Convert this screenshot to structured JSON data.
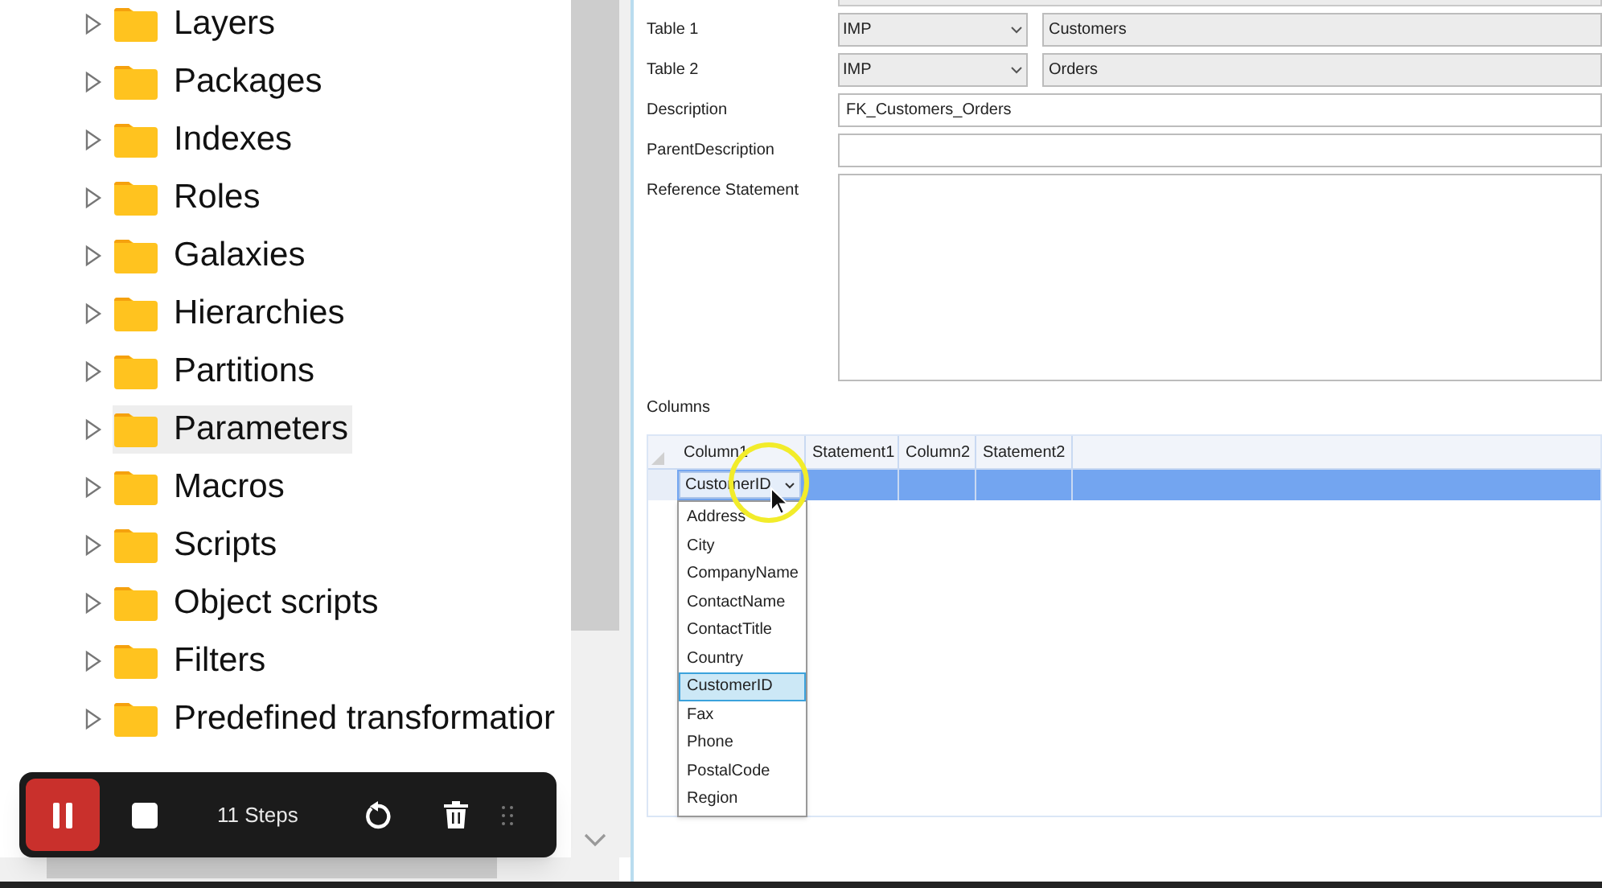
{
  "tree": {
    "items": [
      {
        "label": "Layers",
        "expanded": false,
        "selected": false
      },
      {
        "label": "Packages",
        "expanded": false,
        "selected": false
      },
      {
        "label": "Indexes",
        "expanded": false,
        "selected": false
      },
      {
        "label": "Roles",
        "expanded": false,
        "selected": false
      },
      {
        "label": "Galaxies",
        "expanded": false,
        "selected": false
      },
      {
        "label": "Hierarchies",
        "expanded": false,
        "selected": false
      },
      {
        "label": "Partitions",
        "expanded": false,
        "selected": false
      },
      {
        "label": "Parameters",
        "expanded": false,
        "selected": true
      },
      {
        "label": "Macros",
        "expanded": false,
        "selected": false
      },
      {
        "label": "Scripts",
        "expanded": false,
        "selected": false
      },
      {
        "label": "Object scripts",
        "expanded": false,
        "selected": false
      },
      {
        "label": "Filters",
        "expanded": false,
        "selected": false
      },
      {
        "label": "Predefined transformatior",
        "expanded": false,
        "selected": false
      }
    ]
  },
  "recorder": {
    "paused": true,
    "steps": "11 Steps"
  },
  "form": {
    "table1": {
      "label": "Table 1",
      "schema": "IMP",
      "table": "Customers"
    },
    "table2": {
      "label": "Table 2",
      "schema": "IMP",
      "table": "Orders"
    },
    "description": {
      "label": "Description",
      "value": "FK_Customers_Orders"
    },
    "parent_description": {
      "label": "ParentDescription"
    },
    "reference_statement": {
      "label": "Reference Statement"
    },
    "columns_label": "Columns"
  },
  "grid": {
    "columns": [
      "Column1",
      "Statement1",
      "Column2",
      "Statement2"
    ],
    "rows": [
      {
        "selected": true,
        "cells": [
          "CustomerID"
        ]
      }
    ]
  },
  "dropdown": {
    "items": [
      {
        "label": "Address",
        "selected": false
      },
      {
        "label": "City",
        "selected": false
      },
      {
        "label": "CompanyName",
        "selected": false
      },
      {
        "label": "ContactName",
        "selected": false
      },
      {
        "label": "ContactTitle",
        "selected": false
      },
      {
        "label": "Country",
        "selected": false
      },
      {
        "label": "CustomerID",
        "selected": true
      },
      {
        "label": "Fax",
        "selected": false
      },
      {
        "label": "Phone",
        "selected": false
      },
      {
        "label": "PostalCode",
        "selected": false
      },
      {
        "label": "Region",
        "selected": false
      }
    ]
  }
}
